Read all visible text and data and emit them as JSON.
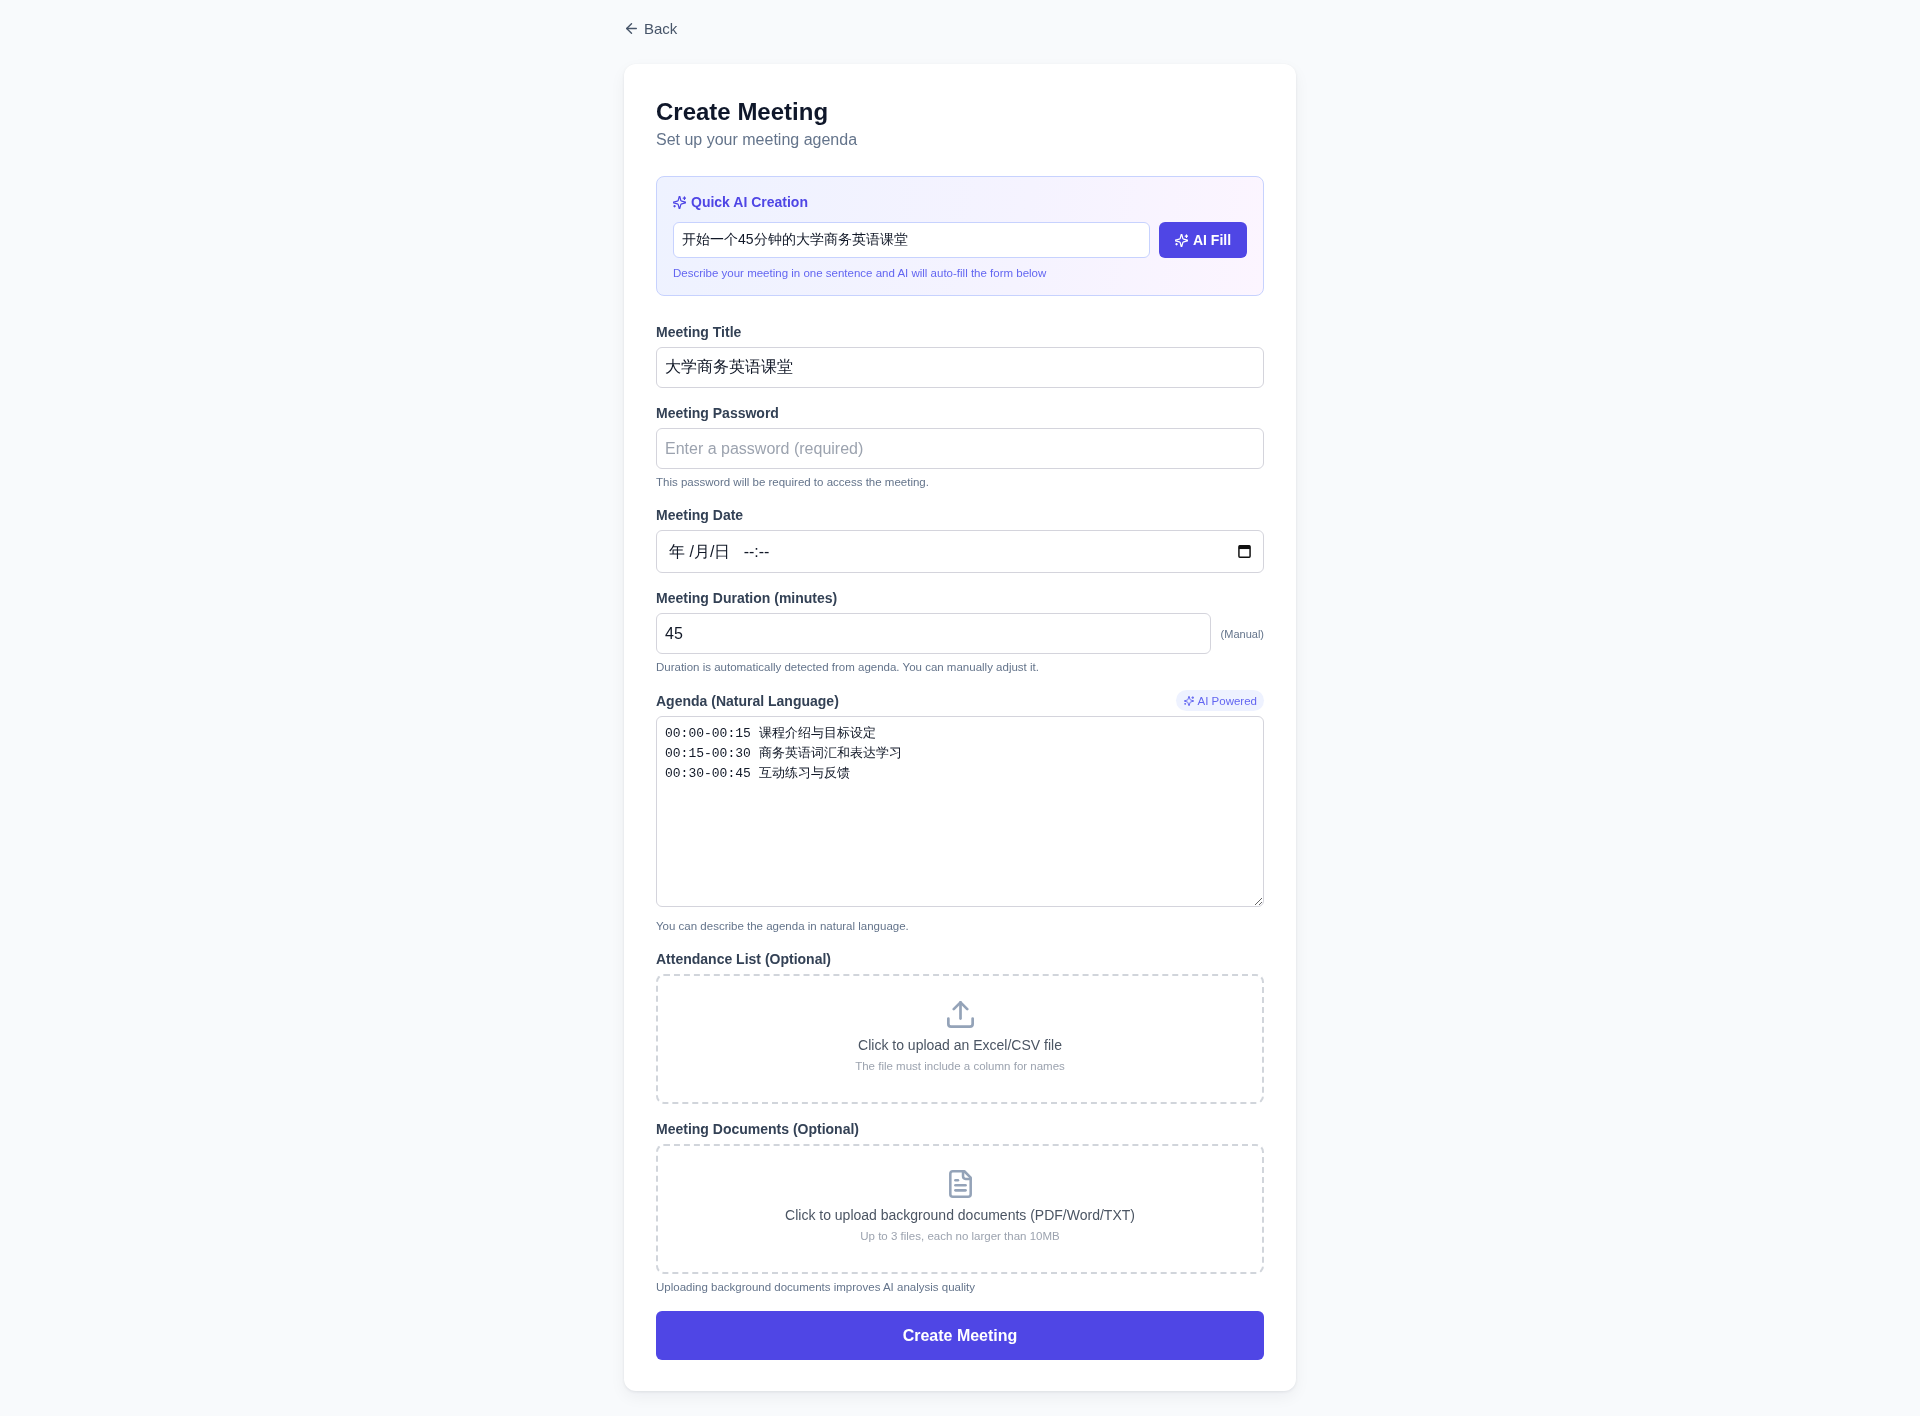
{
  "back_link": {
    "label": "Back"
  },
  "header": {
    "title": "Create Meeting",
    "subtitle": "Set up your meeting agenda"
  },
  "quick_ai": {
    "heading": "Quick AI Creation",
    "prompt": {
      "value": "开始一个45分钟的大学商务英语课堂"
    },
    "button": "AI Fill",
    "hint": "Describe your meeting in one sentence and AI will auto-fill the form below"
  },
  "fields": [
    {
      "kind": "text",
      "label": "Meeting Title",
      "value": "大学商务英语课堂"
    },
    {
      "kind": "password",
      "label": "Meeting Password",
      "placeholder": "Enter a password (required)",
      "hint": "This password will be required to access the meeting."
    },
    {
      "kind": "datetime",
      "label": "Meeting Date",
      "placeholder": "年 /月/日   --:--"
    },
    {
      "kind": "number",
      "label": "Meeting Duration (minutes)",
      "value": "45",
      "note": "(Manual)",
      "hint": "Duration is automatically detected from agenda. You can manually adjust it."
    },
    {
      "kind": "textarea",
      "label": "Agenda (Natural Language)",
      "badge": "AI Powered",
      "value": "00:00-00:15 课程介绍与目标设定\n00:15-00:30 商务英语词汇和表达学习\n00:30-00:45 互动练习与反馈",
      "hint": "You can describe the agenda in natural language."
    }
  ],
  "attendance_upload": {
    "label": "Attendance List (Optional)",
    "prompt": "Click to upload an Excel/CSV file",
    "note": "The file must include a column for names"
  },
  "documents_upload": {
    "label": "Meeting Documents (Optional)",
    "prompt": "Click to upload background documents (PDF/Word/TXT)",
    "note": "Up to 3 files, each no larger than 10MB",
    "hint": "Uploading background documents improves AI analysis quality"
  },
  "submit_button": "Create Meeting"
}
